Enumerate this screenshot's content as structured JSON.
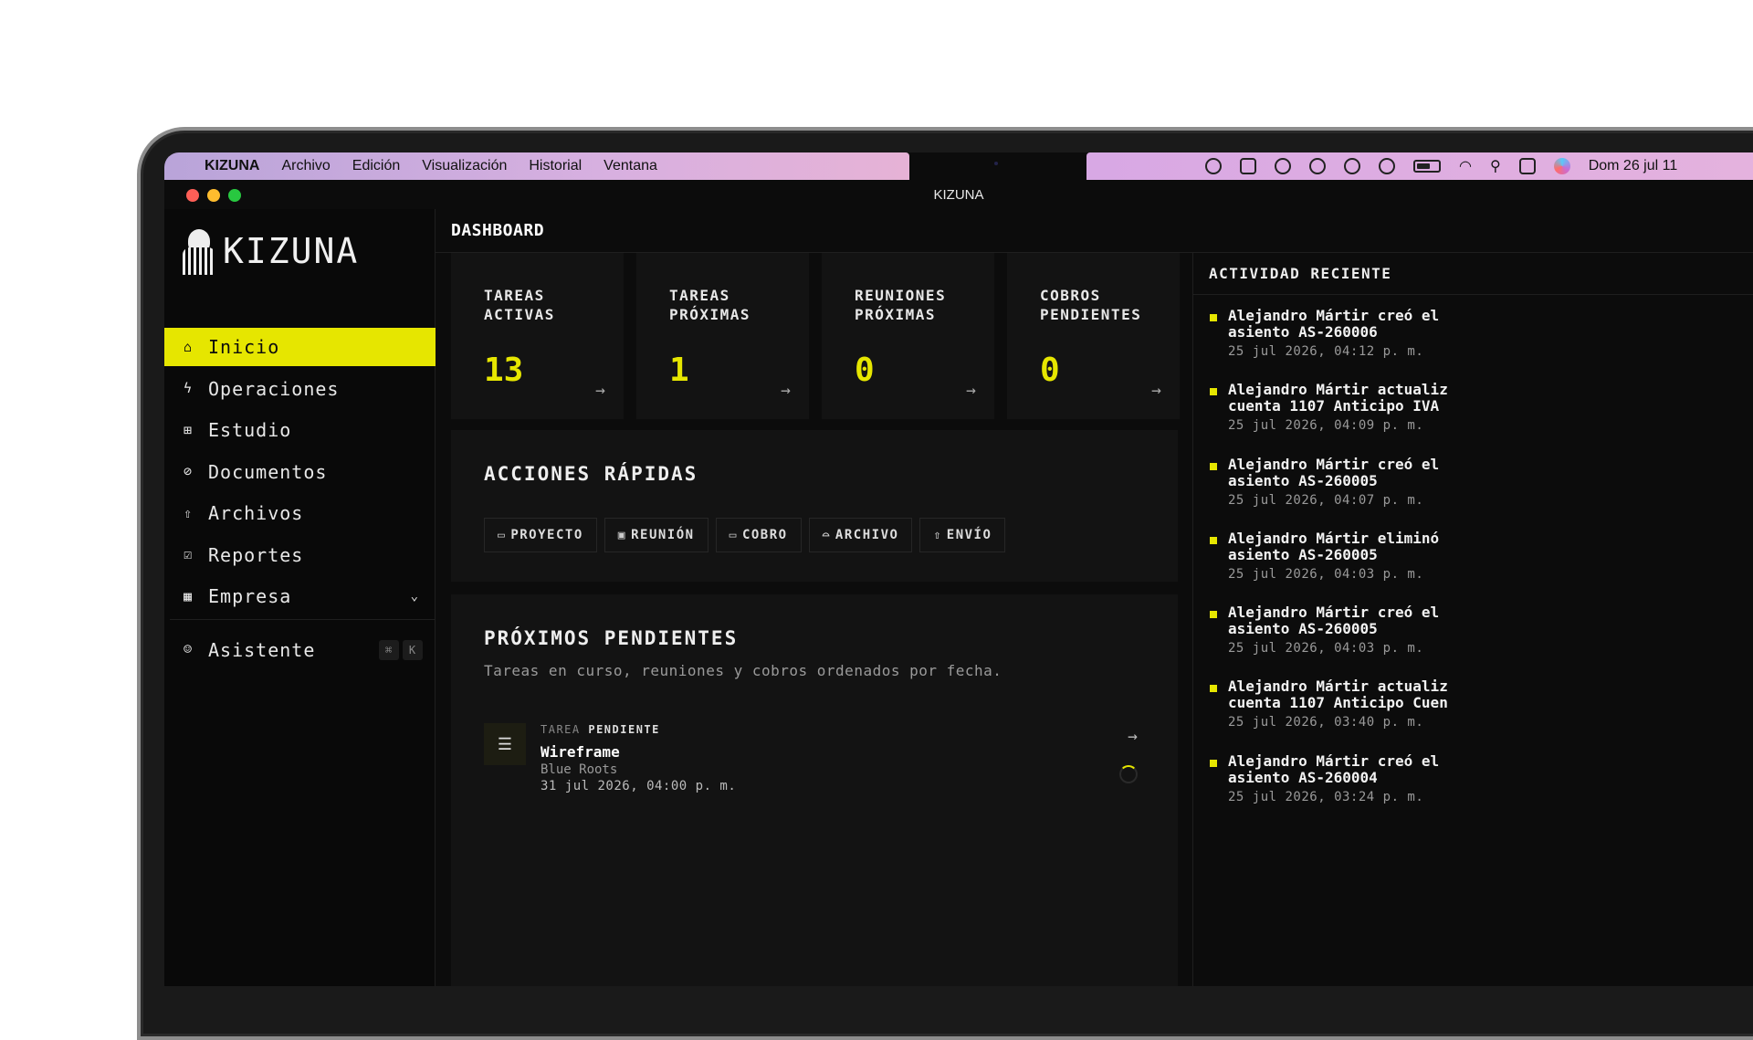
{
  "menubar": {
    "app": "KIZUNA",
    "menus": [
      "Archivo",
      "Edición",
      "Visualización",
      "Historial",
      "Ventana"
    ],
    "date": "Dom 26 jul 11"
  },
  "window": {
    "title": "KIZUNA"
  },
  "sidebar": {
    "logo": "KIZUNA",
    "items": [
      {
        "label": "Inicio",
        "icon": "home-icon"
      },
      {
        "label": "Operaciones",
        "icon": "lightning-icon"
      },
      {
        "label": "Estudio",
        "icon": "grid-icon"
      },
      {
        "label": "Documentos",
        "icon": "paperclip-icon"
      },
      {
        "label": "Archivos",
        "icon": "upload-icon"
      },
      {
        "label": "Reportes",
        "icon": "clipboard-icon"
      },
      {
        "label": "Empresa",
        "icon": "building-icon"
      }
    ],
    "assistant": {
      "label": "Asistente",
      "keys": [
        "⌘",
        "K"
      ]
    }
  },
  "header": {
    "title": "DASHBOARD"
  },
  "stats": [
    {
      "label_1": "TAREAS",
      "label_2": "ACTIVAS",
      "value": "13"
    },
    {
      "label_1": "TAREAS",
      "label_2": "PRÓXIMAS",
      "value": "1"
    },
    {
      "label_1": "REUNIONES",
      "label_2": "PRÓXIMAS",
      "value": "0"
    },
    {
      "label_1": "COBROS",
      "label_2": "PENDIENTES",
      "value": "0"
    }
  ],
  "quick_actions": {
    "title": "ACCIONES RÁPIDAS",
    "buttons": [
      "PROYECTO",
      "REUNIÓN",
      "COBRO",
      "ARCHIVO",
      "ENVÍO"
    ]
  },
  "pending": {
    "title": "PRÓXIMOS PENDIENTES",
    "subtitle": "Tareas en curso, reuniones y cobros ordenados por fecha.",
    "item": {
      "kind": "TAREA",
      "status": "PENDIENTE",
      "title": "Wireframe",
      "client": "Blue Roots",
      "date": "31 jul 2026, 04:00 p. m."
    }
  },
  "activity": {
    "title": "ACTIVIDAD RECIENTE",
    "items": [
      {
        "line1": "Alejandro Mártir creó el",
        "line2": "asiento AS-260006",
        "time": "25 jul 2026, 04:12 p. m."
      },
      {
        "line1": "Alejandro Mártir actualiz",
        "line2": "cuenta 1107 Anticipo IVA",
        "time": "25 jul 2026, 04:09 p. m."
      },
      {
        "line1": "Alejandro Mártir creó el",
        "line2": "asiento AS-260005",
        "time": "25 jul 2026, 04:07 p. m."
      },
      {
        "line1": "Alejandro Mártir eliminó",
        "line2": "asiento AS-260005",
        "time": "25 jul 2026, 04:03 p. m."
      },
      {
        "line1": "Alejandro Mártir creó el",
        "line2": "asiento AS-260005",
        "time": "25 jul 2026, 04:03 p. m."
      },
      {
        "line1": "Alejandro Mártir actualiz",
        "line2": "cuenta 1107 Anticipo Cuen",
        "time": "25 jul 2026, 03:40 p. m."
      },
      {
        "line1": "Alejandro Mártir creó el",
        "line2": "asiento AS-260004",
        "time": "25 jul 2026, 03:24 p. m."
      }
    ]
  },
  "colors": {
    "accent": "#e6e600",
    "background": "#0c0c0c",
    "card": "#131313"
  }
}
